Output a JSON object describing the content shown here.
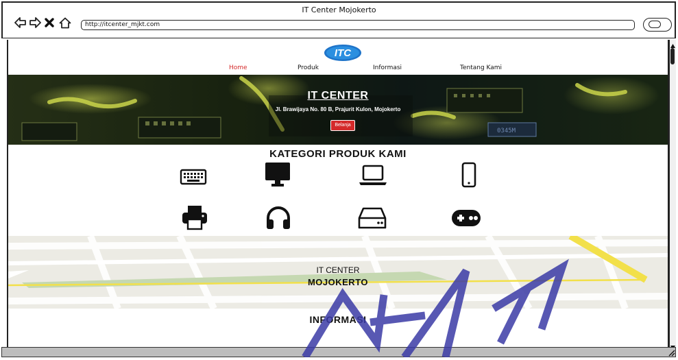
{
  "window": {
    "title": "IT Center Mojokerto",
    "url": "http://itcenter_mjkt.com"
  },
  "toolbar": {
    "back_icon": "back-arrow-icon",
    "forward_icon": "forward-arrow-icon",
    "stop_icon": "close-icon",
    "home_icon": "home-icon",
    "search_icon": "search-icon"
  },
  "nav": {
    "logo_text": "ITC",
    "items": [
      {
        "label": "Home",
        "active": true
      },
      {
        "label": "Produk",
        "active": false
      },
      {
        "label": "Informasi",
        "active": false
      },
      {
        "label": "Tentang Kami",
        "active": false
      }
    ]
  },
  "hero": {
    "title": "IT CENTER",
    "address": "Jl. Brawijaya No. 80 B, Prajurit Kulon, Mojokerto",
    "button_label": "Belanja"
  },
  "categories": {
    "title": "KATEGORI PRODUK KAMI",
    "icons": [
      "keyboard-icon",
      "monitor-icon",
      "laptop-icon",
      "smartphone-icon",
      "printer-icon",
      "headphones-icon",
      "hard-drive-icon",
      "gamepad-icon"
    ]
  },
  "map": {
    "line1": "IT CENTER",
    "line2": "MOJOKERTO"
  },
  "info": {
    "title": "INFORMASI"
  },
  "colors": {
    "active_nav": "#d42a2a",
    "button": "#d42a2a",
    "hero_bg": "#1a2410",
    "map_bg": "#ecebe4",
    "watermark": "#3b3ba6"
  }
}
